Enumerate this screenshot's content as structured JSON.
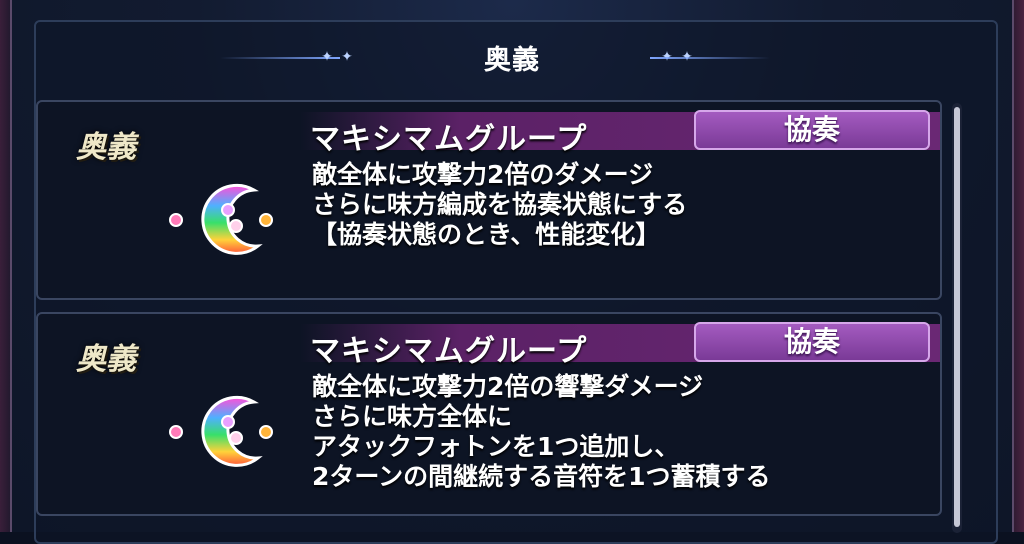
{
  "header": {
    "title": "奥義"
  },
  "skills": [
    {
      "section_label": "奥義",
      "name": "マキシマムグループ",
      "tag": "協奏",
      "icon": "crescent-moon-notes-icon",
      "lines": [
        "敵全体に攻撃力2倍のダメージ",
        "さらに味方編成を協奏状態にする",
        "【協奏状態のとき、性能変化】"
      ]
    },
    {
      "section_label": "奥義",
      "name": "マキシマムグループ",
      "tag": "協奏",
      "icon": "crescent-moon-notes-icon",
      "lines": [
        "敵全体に攻撃力2倍の響撃ダメージ",
        "さらに味方全体に",
        "アタックフォトンを1つ追加し、",
        "2ターンの間継続する音符を1つ蓄積する"
      ]
    }
  ],
  "colors": {
    "accent_purple": "#7a3a97",
    "name_bar": "#6a2874",
    "background": "#0e1628"
  }
}
